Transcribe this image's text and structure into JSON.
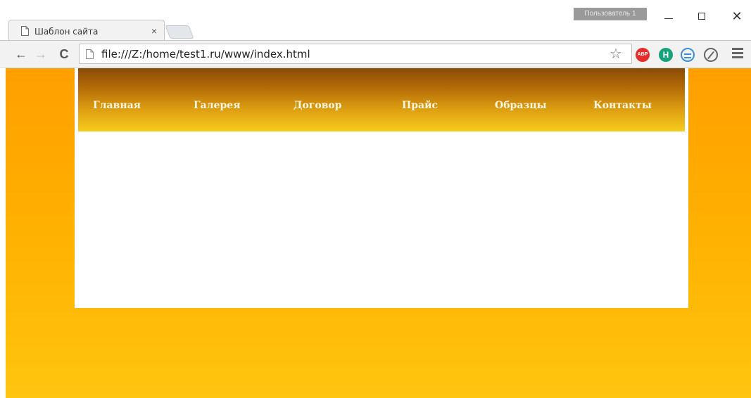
{
  "browser": {
    "tab": {
      "title": "Шаблон сайта",
      "close_label": "×"
    },
    "profile_label": "Пользователь 1",
    "window_controls": {
      "close_label": "✕"
    },
    "toolbar": {
      "url": "file:///Z:/home/test1.ru/www/index.html",
      "back_glyph": "←",
      "forward_glyph": "→",
      "reload_glyph": "C",
      "star_glyph": "☆",
      "extensions": [
        {
          "name": "adblock-plus",
          "label": "ABP",
          "color": "#e62b2b"
        },
        {
          "name": "h-extension",
          "label": "H",
          "color": "#16a37c"
        },
        {
          "name": "sync-extension",
          "color": "#3b8fd9"
        },
        {
          "name": "compass-extension",
          "color": "#666666"
        }
      ]
    }
  },
  "page": {
    "background_gradient": [
      "#ff9f00",
      "#ffc510"
    ],
    "nav": {
      "items": [
        {
          "label": "Главная"
        },
        {
          "label": "Галерея"
        },
        {
          "label": "Договор"
        },
        {
          "label": "Прайс"
        },
        {
          "label": "Образцы"
        },
        {
          "label": "Контакты"
        }
      ]
    }
  }
}
